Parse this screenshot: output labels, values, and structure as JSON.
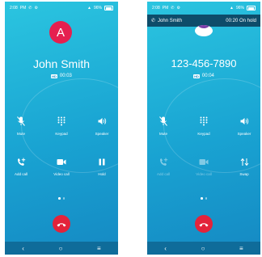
{
  "status_bar": {
    "time_1": "2:08",
    "time_2": "2:08",
    "ampm": "PM",
    "battery": "96%"
  },
  "call_screen": {
    "avatar_letter": "A",
    "caller_name": "John Smith",
    "duration": "00:03",
    "hd_badge": "HD",
    "buttons": [
      {
        "label": "Mute",
        "icon": "mute-icon"
      },
      {
        "label": "Keypad",
        "icon": "keypad-icon"
      },
      {
        "label": "Speaker",
        "icon": "speaker-icon"
      },
      {
        "label": "Add call",
        "icon": "add-call-icon"
      },
      {
        "label": "Video call",
        "icon": "video-call-icon"
      },
      {
        "label": "Hold",
        "icon": "pause-icon"
      }
    ],
    "end_call_icon": "end-call-icon"
  },
  "held_call_screen": {
    "banner_name": "John Smith",
    "banner_status": "00:20 On hold",
    "number": "123-456-7890",
    "duration": "00:04",
    "hd_badge": "HD",
    "buttons": [
      {
        "label": "Mute",
        "icon": "mute-icon"
      },
      {
        "label": "Keypad",
        "icon": "keypad-icon"
      },
      {
        "label": "Speaker",
        "icon": "speaker-icon"
      },
      {
        "label": "Add call",
        "icon": "add-call-icon"
      },
      {
        "label": "Video call",
        "icon": "video-call-icon"
      },
      {
        "label": "Swap",
        "icon": "swap-icon"
      }
    ],
    "end_call_icon": "end-call-icon"
  },
  "nav_bar": {
    "back": "‹",
    "home": "○",
    "recents": "≡"
  },
  "colors": {
    "background_gradient_top": "#2bc5e0",
    "background_gradient_bottom": "#1589c3",
    "avatar": "#e5204f",
    "end_call": "#e3233a",
    "hold_banner": "#0e4c6a",
    "nav_bar": "#0f6c9a"
  }
}
